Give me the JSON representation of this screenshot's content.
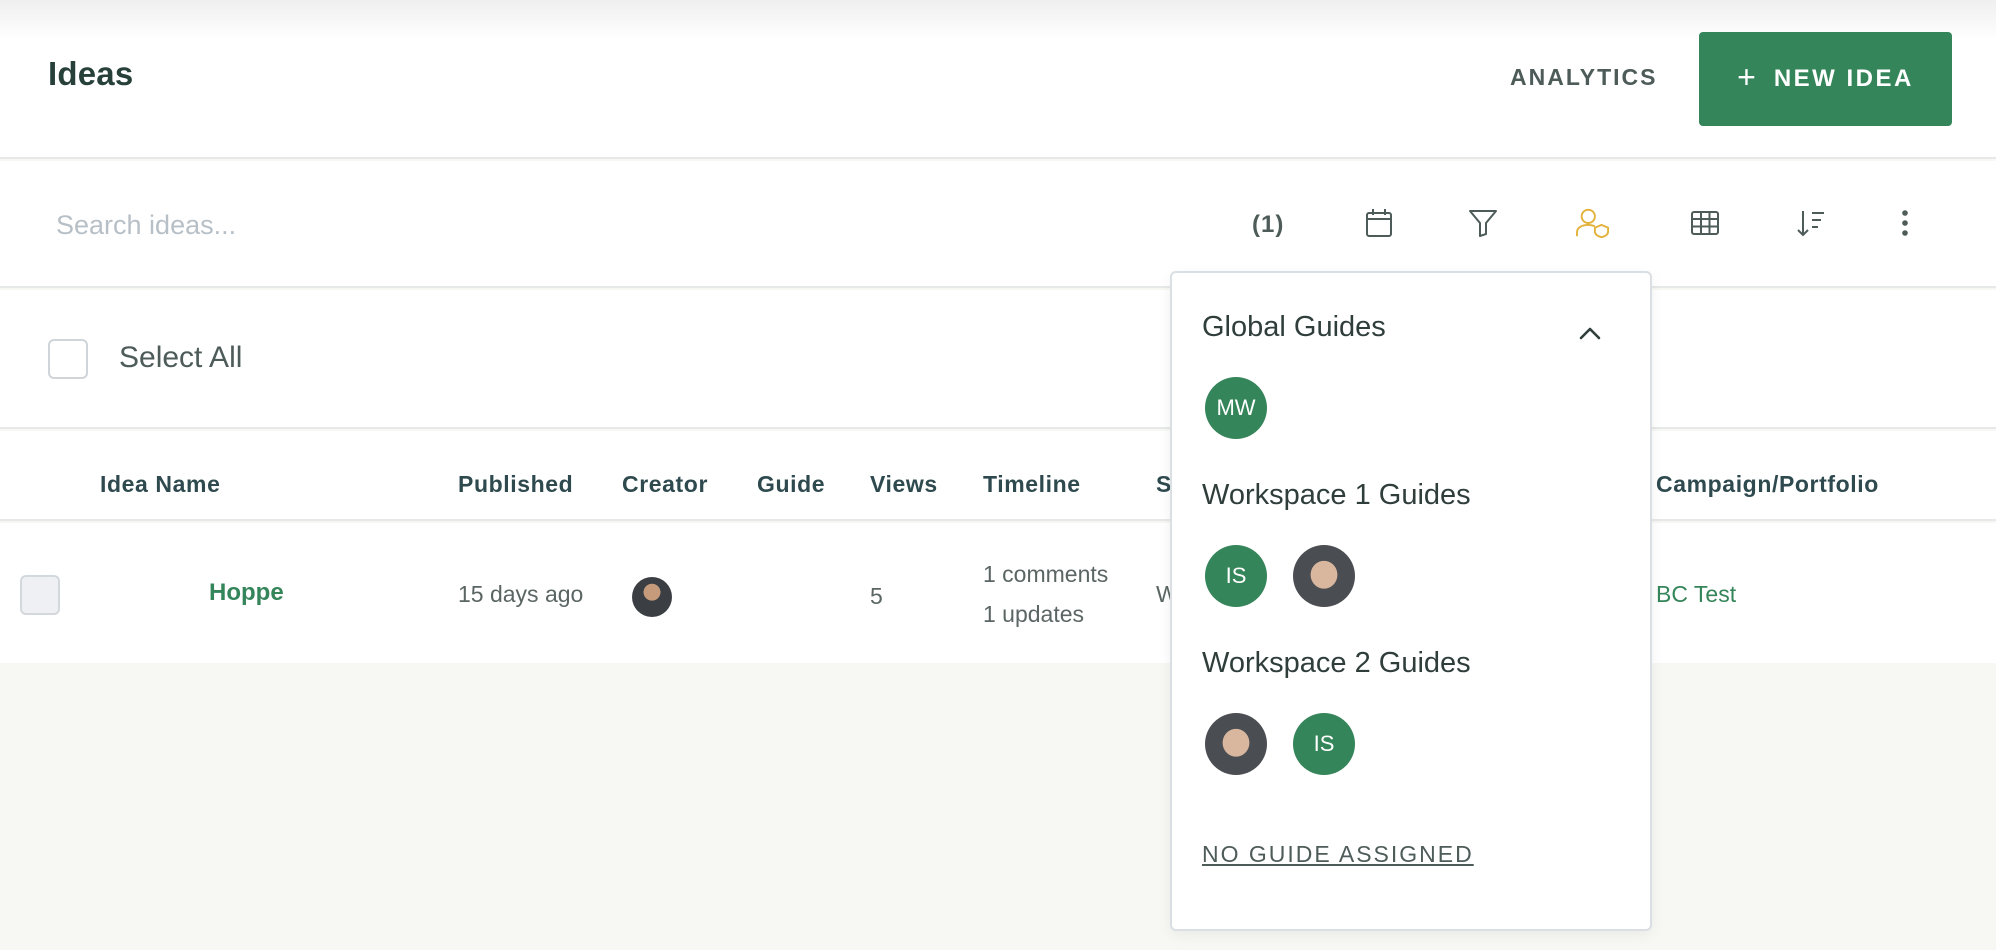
{
  "header": {
    "title": "Ideas",
    "analytics_label": "ANALYTICS",
    "new_idea_label": "NEW IDEA",
    "new_idea_icon": "plus-icon"
  },
  "toolbar": {
    "search_placeholder": "Search ideas...",
    "search_value": "",
    "filter_count": "(1)",
    "icons": [
      "calendar-icon",
      "filter-icon",
      "guide-user-icon",
      "table-icon",
      "sort-icon",
      "more-vertical-icon"
    ],
    "active_icon_color": "#e2b23a"
  },
  "select_all": {
    "label": "Select All"
  },
  "table": {
    "columns": [
      "Idea Name",
      "Published",
      "Creator",
      "Guide",
      "Views",
      "Timeline",
      "S",
      "Campaign/Portfolio"
    ],
    "rows": [
      {
        "idea_name": "Hoppe",
        "published": "15 days ago",
        "creator_avatar": "creator-photo",
        "guide": "",
        "views": "5",
        "timeline_comments": "1 comments",
        "timeline_updates": "1 updates",
        "status_partial": "W",
        "campaign": "BC Test"
      }
    ]
  },
  "guide_dropdown": {
    "groups": [
      {
        "title": "Global Guides",
        "guides": [
          "MW"
        ]
      },
      {
        "title": "Workspace 1 Guides",
        "guides": [
          "IS",
          "photo"
        ]
      },
      {
        "title": "Workspace 2 Guides",
        "guides": [
          "photo",
          "IS"
        ]
      }
    ],
    "no_guide_label": "NO GUIDE ASSIGNED"
  },
  "colors": {
    "brand_green": "#35855a",
    "page_background": "#f7f8f4",
    "heading_text": "#27403a"
  }
}
